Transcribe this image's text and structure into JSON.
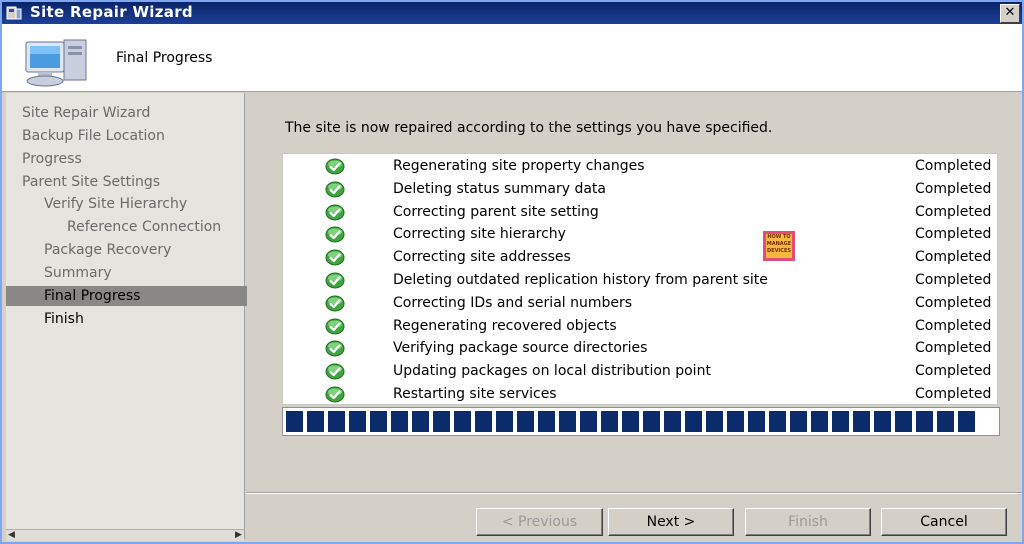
{
  "window": {
    "title": "Site Repair Wizard",
    "close_label": "✕"
  },
  "header": {
    "title": "Final Progress"
  },
  "nav": {
    "items": [
      {
        "label": "Site Repair Wizard"
      },
      {
        "label": "Backup File Location"
      },
      {
        "label": "Progress"
      },
      {
        "label": "Parent Site Settings"
      },
      {
        "label": "Verify Site Hierarchy"
      },
      {
        "label": "Reference Connection"
      },
      {
        "label": "Package Recovery"
      },
      {
        "label": "Summary"
      },
      {
        "label": "Final Progress"
      },
      {
        "label": "Finish"
      }
    ],
    "active_index": 8
  },
  "main": {
    "intro": "The site is now repaired according to the settings you have specified.",
    "tasks": [
      {
        "name": "Regenerating site property changes",
        "status": "Completed"
      },
      {
        "name": "Deleting status summary data",
        "status": "Completed"
      },
      {
        "name": "Correcting parent site setting",
        "status": "Completed"
      },
      {
        "name": "Correcting site hierarchy",
        "status": "Completed"
      },
      {
        "name": "Correcting site addresses",
        "status": "Completed"
      },
      {
        "name": "Deleting outdated replication history from parent site",
        "status": "Completed"
      },
      {
        "name": "Correcting IDs and serial numbers",
        "status": "Completed"
      },
      {
        "name": "Regenerating recovered objects",
        "status": "Completed"
      },
      {
        "name": "Verifying package source directories",
        "status": "Completed"
      },
      {
        "name": "Updating packages on local distribution point",
        "status": "Completed"
      },
      {
        "name": "Restarting site services",
        "status": "Completed"
      }
    ],
    "progress_fraction": 1.0
  },
  "watermark": {
    "line1": "HOW TO",
    "line2": "MANAGE",
    "line3": "DEVICES"
  },
  "buttons": {
    "previous": "< Previous",
    "next": "Next >",
    "finish": "Finish",
    "cancel": "Cancel"
  },
  "colors": {
    "titlebar": "#0a246a",
    "active_nav": "#8a8887",
    "progress": "#0b2b6b",
    "check": "#3fa63f"
  }
}
